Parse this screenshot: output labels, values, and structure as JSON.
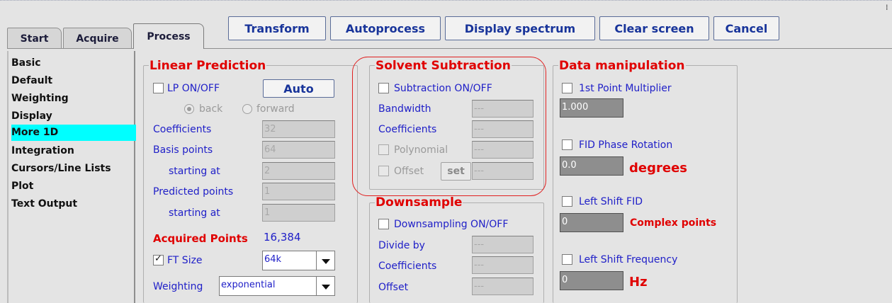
{
  "tabs": [
    {
      "label": "Start"
    },
    {
      "label": "Acquire"
    },
    {
      "label": "Process"
    }
  ],
  "toolbar": {
    "transform": "Transform",
    "autoprocess": "Autoprocess",
    "display_spectrum": "Display spectrum",
    "clear_screen": "Clear screen",
    "cancel": "Cancel"
  },
  "sidebar": {
    "items": [
      {
        "label": "Basic"
      },
      {
        "label": "Default"
      },
      {
        "label": "Weighting"
      },
      {
        "label": "Display"
      },
      {
        "label": "More 1D"
      },
      {
        "label": "Integration"
      },
      {
        "label": "Cursors/Line Lists"
      },
      {
        "label": "Plot"
      },
      {
        "label": "Text Output"
      }
    ],
    "selected": "More 1D"
  },
  "linear_prediction": {
    "title": "Linear Prediction",
    "lp_toggle": "LP ON/OFF",
    "lp_checked": false,
    "auto_button": "Auto",
    "back": "back",
    "forward": "forward",
    "direction": "back",
    "coefficients_label": "Coefficients",
    "coefficients_value": "32",
    "basis_points_label": "Basis points",
    "basis_points_value": "64",
    "starting_at_label": "starting at",
    "basis_start_value": "2",
    "predicted_points_label": "Predicted points",
    "predicted_points_value": "1",
    "predicted_start_value": "1",
    "acquired_points_label": "Acquired Points",
    "acquired_points_value": "16,384",
    "ft_size_label": "FT Size",
    "ft_size_checked": true,
    "ft_size_value": "64k",
    "weighting_label": "Weighting",
    "weighting_value": "exponential"
  },
  "solvent_subtraction": {
    "title": "Solvent Subtraction",
    "toggle": "Subtraction ON/OFF",
    "bandwidth_label": "Bandwidth",
    "bandwidth_value": "---",
    "coefficients_label": "Coefficients",
    "coefficients_value": "---",
    "polynomial_label": "Polynomial",
    "polynomial_value": "---",
    "offset_label": "Offset",
    "set_button": "set",
    "offset_value": "---"
  },
  "downsample": {
    "title": "Downsample",
    "toggle": "Downsampling ON/OFF",
    "divide_by_label": "Divide by",
    "divide_by_value": "---",
    "coefficients_label": "Coefficients",
    "coefficients_value": "---",
    "offset_label": "Offset",
    "offset_value": "---"
  },
  "data_manipulation": {
    "title": "Data manipulation",
    "first_point_label": "1st Point Multiplier",
    "first_point_value": "1.000",
    "fid_phase_label": "FID Phase Rotation",
    "fid_phase_value": "0.0",
    "degrees_unit": "degrees",
    "left_shift_fid_label": "Left Shift FID",
    "left_shift_fid_value": "0",
    "complex_points_unit": "Complex points",
    "left_shift_freq_label": "Left Shift Frequency",
    "left_shift_freq_value": "0",
    "hz_unit": "Hz"
  },
  "colors": {
    "accent_blue": "#2020c8",
    "title_red": "#e00000",
    "selection_cyan": "#00ffff",
    "button_text": "#18349a"
  }
}
